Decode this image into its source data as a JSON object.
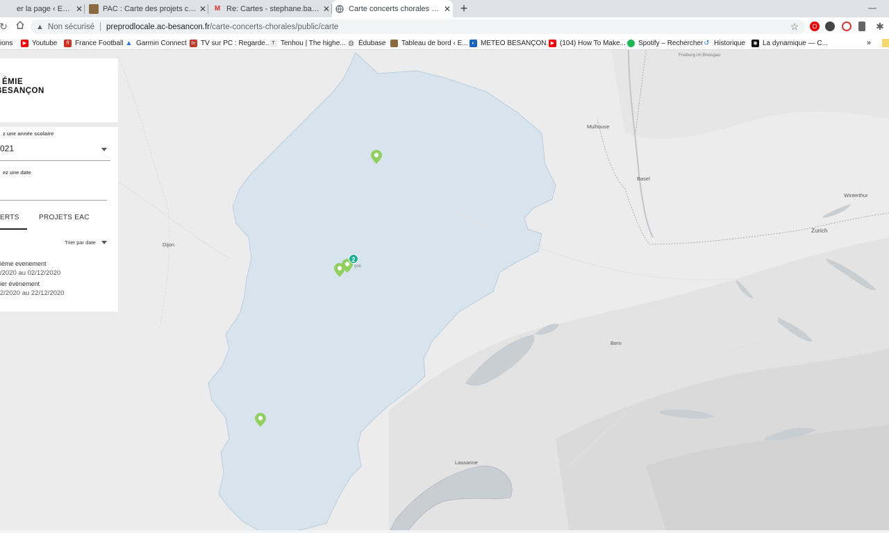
{
  "browser": {
    "tabs": [
      {
        "title": "er la page ‹ EDUCATION M",
        "icon": "page-icon"
      },
      {
        "title": "PAC : Carte des projets chorales/(",
        "icon": "site-favicon"
      },
      {
        "title": "Re: Cartes - stephane.barcon@gr",
        "icon": "gmail-icon"
      },
      {
        "title": "Carte concerts chorales & Projet",
        "icon": "globe-icon"
      }
    ],
    "new_tab": "+",
    "close": "✕",
    "security": "Non sécurisé",
    "url_host": "preprodlocale.ac-besancon.fr",
    "url_path": "/carte-concerts-chorales/public/carte",
    "bookmarks": [
      {
        "label": "ions",
        "icon": "apps-icon",
        "color": "#4285f4"
      },
      {
        "label": "Youtube",
        "icon": "youtube-icon",
        "color": "#ff0000"
      },
      {
        "label": "France Football",
        "icon": "ff-icon",
        "color": "#d62e1f"
      },
      {
        "label": "Garmin Connect",
        "icon": "garmin-icon",
        "color": "#1a73e8"
      },
      {
        "label": "TV sur PC : Regarde...",
        "icon": "tv-icon",
        "color": "#c0392b"
      },
      {
        "label": "Tenhou | The highe...",
        "icon": "tenhou-icon",
        "color": "#555555"
      },
      {
        "label": "Édubase",
        "icon": "globe-icon",
        "color": "#555555"
      },
      {
        "label": "Tableau de bord ‹ E...",
        "icon": "dashboard-icon",
        "color": "#8b6b3d"
      },
      {
        "label": "METEO BESANÇON...",
        "icon": "meteo-icon",
        "color": "#1565c0"
      },
      {
        "label": "(104) How To Make...",
        "icon": "youtube-icon",
        "color": "#ff0000"
      },
      {
        "label": "Spotify – Rechercher",
        "icon": "spotify-icon",
        "color": "#1db954"
      },
      {
        "label": "Historique",
        "icon": "history-icon",
        "color": "#1a73e8"
      },
      {
        "label": "La dynamique — C...",
        "icon": "dynamique-icon",
        "color": "#111111"
      }
    ],
    "more": "»"
  },
  "panel": {
    "logo_line1": "ÉMIE",
    "logo_line2": "BESANÇON",
    "year_label": "z une année scolaire",
    "year_value": "021",
    "date_label": "ez une date",
    "date_value": "",
    "tab_concerts": "ERTS",
    "tab_projets": "PROJETS EAC",
    "sort_label": "Trier par date",
    "events": [
      {
        "title": "ième evenement",
        "dates": "/2020 au 02/12/2020"
      },
      {
        "title": "ier évènement",
        "dates": "2/2020 au 22/12/2020"
      }
    ]
  },
  "map": {
    "cluster_count": "2",
    "region_color": "#d4e3ee",
    "marker_color": "#8fd15c",
    "cluster_color": "#1ab394",
    "labels": [
      "Freiburg im Breisgau",
      "Mulhouse",
      "Basel",
      "Winterthur",
      "Zurich",
      "Dijon",
      "Bern",
      "Lausanne",
      "çon"
    ]
  }
}
